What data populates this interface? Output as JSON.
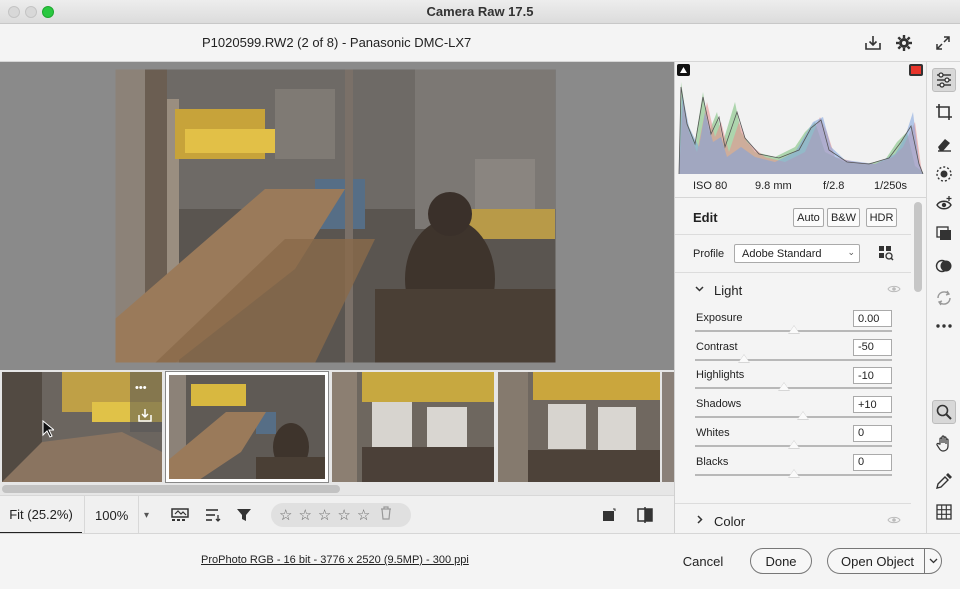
{
  "window": {
    "title": "Camera Raw 17.5"
  },
  "header": {
    "filename": "P1020599.RW2 (2 of 8)  -  Panasonic DMC-LX7",
    "icons": [
      "save-image-icon",
      "settings-gear-icon",
      "fullscreen-icon"
    ]
  },
  "histogram": {
    "shadow_clip_icon": "shadow-clipping-icon",
    "highlight_clip_icon": "highlight-clipping-icon",
    "highlight_clip_color": "#e8352b"
  },
  "exif": {
    "iso": "ISO 80",
    "focal": "9.8 mm",
    "aperture": "f/2.8",
    "shutter": "1/250s"
  },
  "edit": {
    "title": "Edit",
    "auto_label": "Auto",
    "bw_label": "B&W",
    "hdr_label": "HDR",
    "profile_label": "Profile",
    "profile_value": "Adobe Standard"
  },
  "light": {
    "title": "Light",
    "sliders": [
      {
        "label": "Exposure",
        "value": "0.00",
        "position": 0.5
      },
      {
        "label": "Contrast",
        "value": "-50",
        "position": 0.25
      },
      {
        "label": "Highlights",
        "value": "-10",
        "position": 0.45
      },
      {
        "label": "Shadows",
        "value": "+10",
        "position": 0.55
      },
      {
        "label": "Whites",
        "value": "0",
        "position": 0.5
      },
      {
        "label": "Blacks",
        "value": "0",
        "position": 0.5
      }
    ]
  },
  "color": {
    "title": "Color"
  },
  "toolbar": {
    "zoom_fit": "Fit (25.2%)",
    "zoom_100": "100%",
    "stars": [
      "☆",
      "☆",
      "☆",
      "☆",
      "☆"
    ]
  },
  "footer": {
    "workflow": "ProPhoto RGB - 16 bit - 3776 x 2520 (9.5MP) - 300 ppi",
    "cancel": "Cancel",
    "done": "Done",
    "open_object": "Open Object"
  },
  "filmstrip": {
    "thumb_more": "•••",
    "selected_index": 1
  },
  "colors": {
    "accent": "#2ac840",
    "panel_bg": "#f4f4f4",
    "preview_bg": "#8a8a8a"
  }
}
